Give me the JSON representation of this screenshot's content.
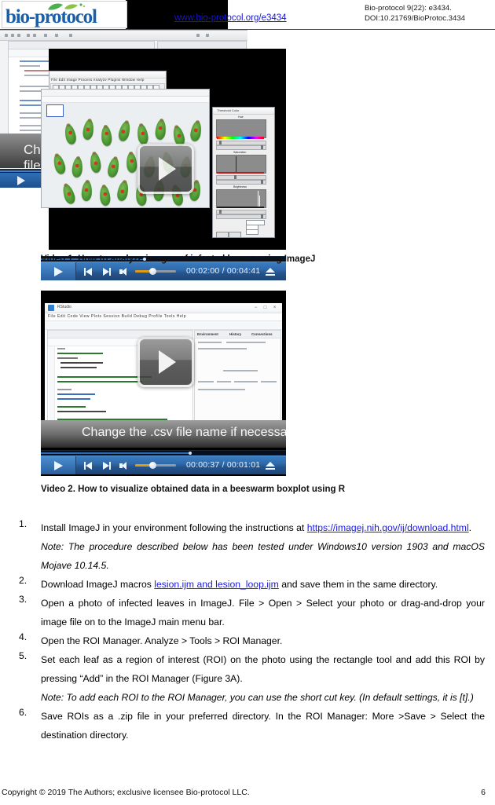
{
  "header": {
    "logo_text": "bio-protocol",
    "url": "www.bio-protocol.org/e3434",
    "citation_line1": "Bio-protocol 9(22): e3434.",
    "citation_line2": "DOI:10.21769/BioProtoc.3434"
  },
  "video1": {
    "caption": "Video 1. How to analyze images of infected leaves using ImageJ",
    "current_time": "00:02:00",
    "total_time": "00:04:41",
    "time_display": "00:02:00 / 00:04:41",
    "play_label": "Play",
    "threshold_window_title": "Threshold Color",
    "threshold_labels": [
      "Hue",
      "Saturation",
      "Brightness"
    ],
    "imagej_menu": "File  Edit  Image  Process  Analyze  Plugins  Window  Help"
  },
  "video1_background": {
    "caption_overlay": "Change the .csv file name if necessary"
  },
  "video2": {
    "caption": "Video 2. How to visualize obtained data in a beeswarm boxplot using R",
    "current_time": "00:00:37",
    "total_time": "00:01:01",
    "time_display": "00:00:37 / 00:01:01",
    "overlay_caption": "Change the .csv file name if necessary",
    "rstudio_title": "RStudio",
    "rstudio_menu": "File  Edit  Code  View  Plots  Session  Build  Debug  Profile  Tools  Help",
    "rstudio_pane_tabs": [
      "Environment",
      "History",
      "Connections"
    ]
  },
  "steps": [
    {
      "number": "1.",
      "text_before": "Install ImageJ in your environment following the instructions at ",
      "link": "https://imagej.nih.gov/ij/download.html",
      "text_after": ".",
      "note": "Note: The procedure described below has been tested under Windows10 version 1903 and macOS Mojave 10.14.5."
    },
    {
      "number": "2.",
      "text_before": "Download ImageJ macros ",
      "link": "lesion.ijm and lesion_loop.ijm",
      "text_after": " and save them in the same directory.",
      "note": ""
    },
    {
      "number": "3.",
      "text_before": "Open a photo of infected leaves in ImageJ. File > Open > Select your photo or drag-and-drop your image file on to the ImageJ main menu bar.",
      "link": "",
      "text_after": "",
      "note": ""
    },
    {
      "number": "4.",
      "text_before": "Open the ROI Manager. Analyze > Tools > ROI Manager.",
      "link": "",
      "text_after": "",
      "note": ""
    },
    {
      "number": "5.",
      "text_before": "Set each leaf as a region of interest (ROI) on the photo using the rectangle tool and add this ROI by pressing “Add” in the ROI Manager (Figure 3A).",
      "link": "",
      "text_after": "",
      "note": "Note: To add each ROI to the ROI Manager, you can use the short cut key. (In default settings, it is [t].)"
    },
    {
      "number": "6.",
      "text_before": "Save ROIs as a .zip file in your preferred directory. In the ROI Manager: More >Save > Select the destination directory.",
      "link": "",
      "text_after": "",
      "note": ""
    }
  ],
  "footer": {
    "copyright": "Copyright © 2019 The Authors; exclusive licensee Bio-protocol LLC.",
    "page_number": "6"
  },
  "colors": {
    "logo_blue": "#1a5fa8",
    "link_blue": "#1a1ae6",
    "player_blue": "#2f6bac",
    "volume_orange": "#e09b12",
    "leaf_green": "#4e9a33",
    "lesion_red": "#d9331d"
  }
}
